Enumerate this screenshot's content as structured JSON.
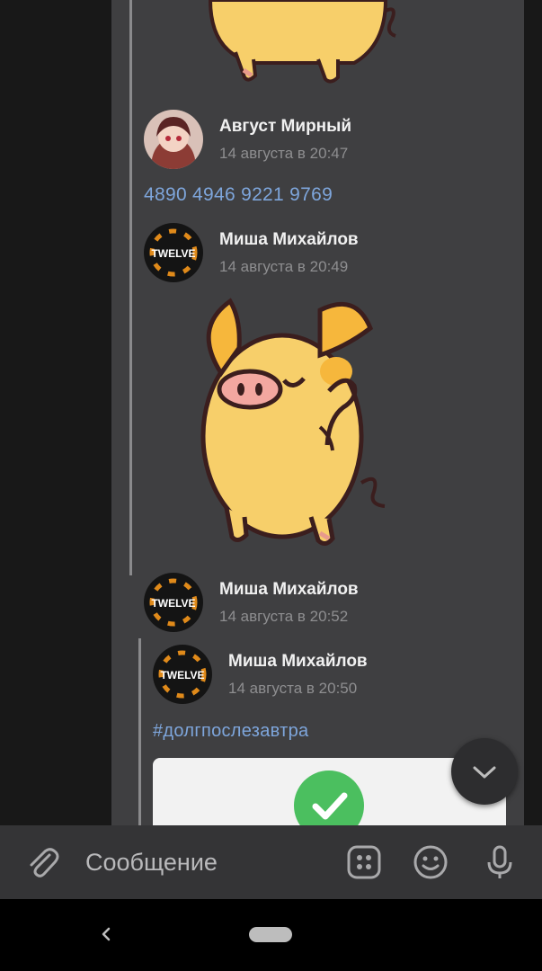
{
  "messages": [
    {
      "author": "Август Мирный",
      "time": "14 августа в 20:47",
      "text": "4890 4946 9221 9769"
    },
    {
      "author": "Миша Михайлов",
      "time": "14 августа в 20:49",
      "avatar_text": "TWELVE",
      "sticker": "pig-wave-sticker"
    },
    {
      "author": "Миша Михайлов",
      "time": "14 августа в 20:52",
      "avatar_text": "TWELVE"
    }
  ],
  "forwarded": {
    "author": "Миша Михайлов",
    "time": "14 августа в 20:50",
    "avatar_text": "TWELVE",
    "hashtag": "#долгпослезавтра"
  },
  "composer": {
    "placeholder": "Сообщение"
  },
  "colors": {
    "panel": "#3f3f41",
    "link": "#7ea6dc",
    "check": "#4bbf5f",
    "pig": "#f7cf6a"
  },
  "icons": [
    "attach-icon",
    "sticker-icon",
    "emoji-icon",
    "mic-icon",
    "chevron-down-icon",
    "back-icon"
  ]
}
